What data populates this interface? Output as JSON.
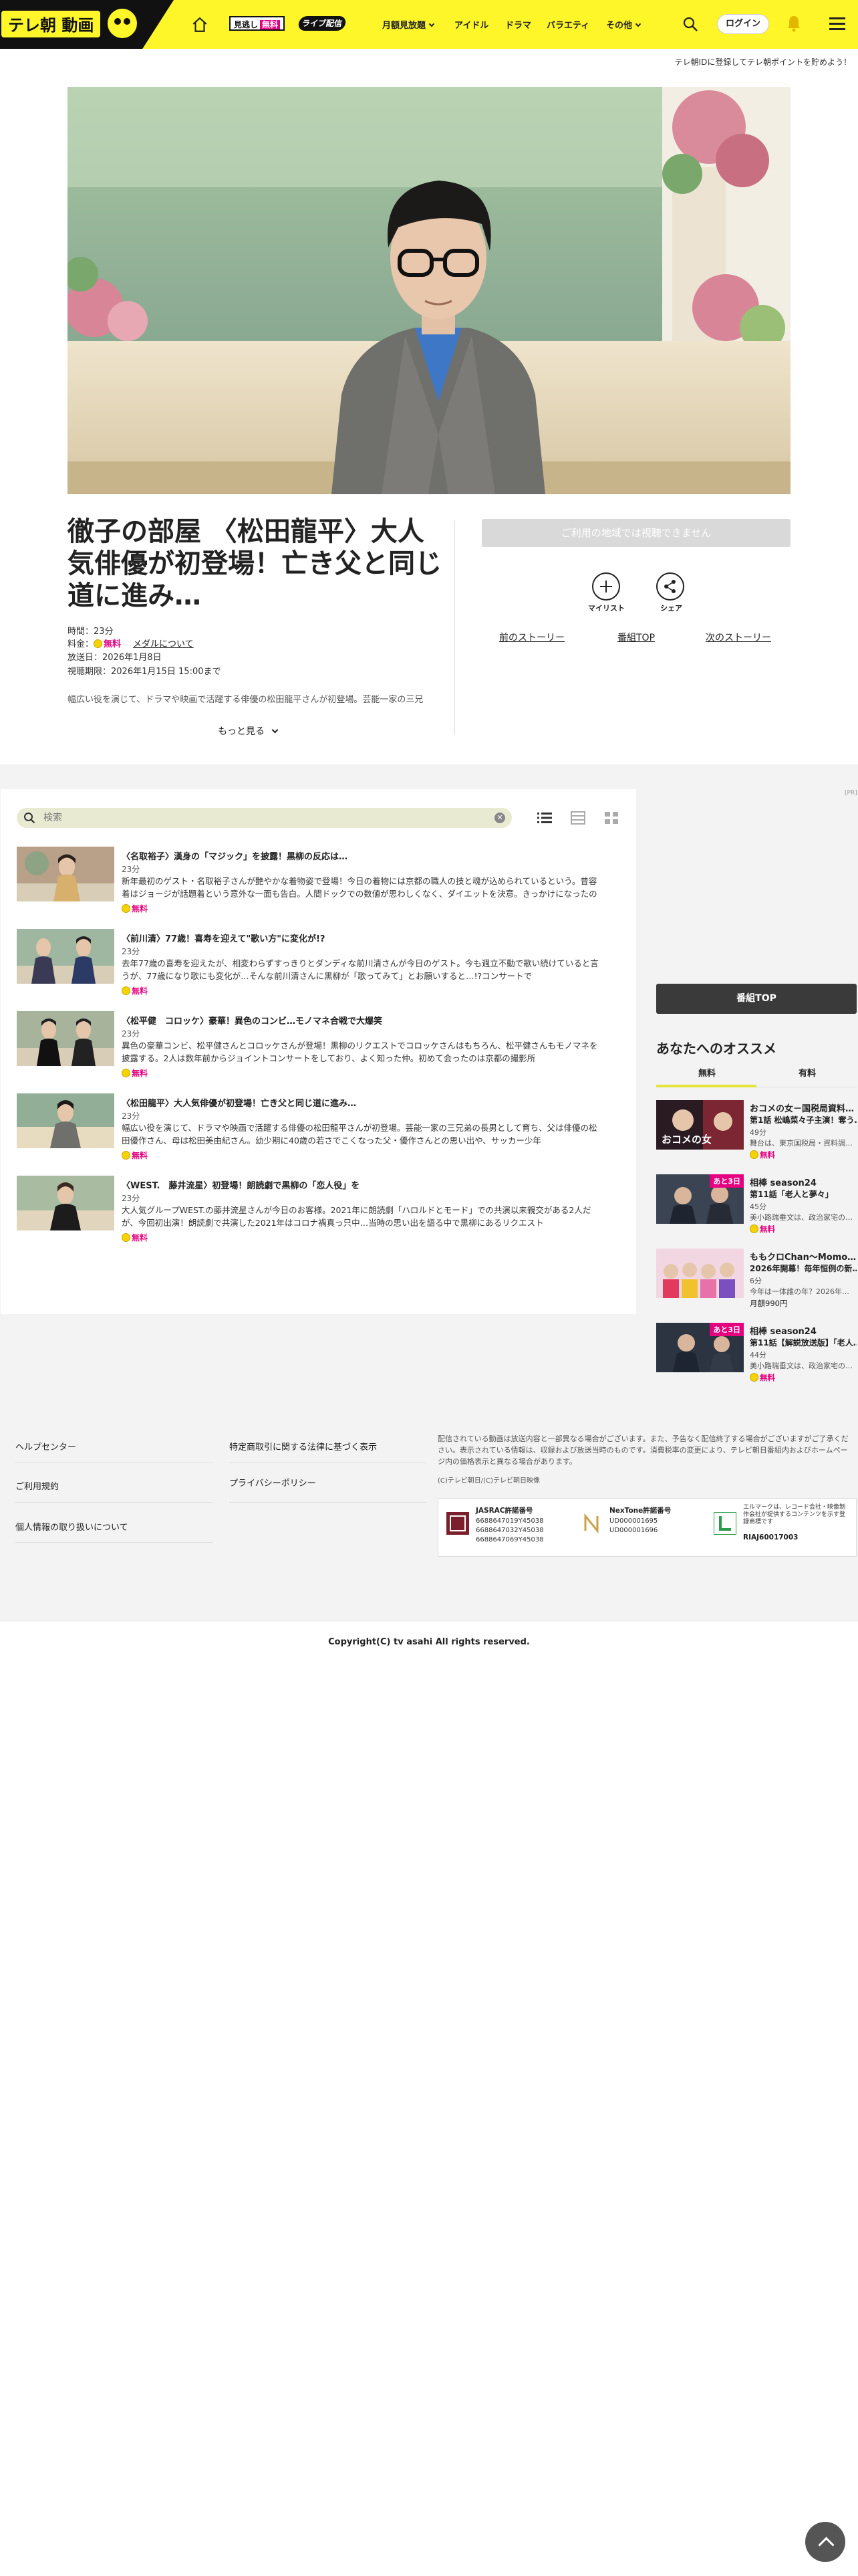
{
  "header": {
    "logo_text": "テレ朝 動画",
    "pill_free_prefix": "見逃し",
    "pill_free_badge": "無料",
    "pill_live": "ライブ配信",
    "nav_items": [
      "月額見放題",
      "アイドル",
      "ドラマ",
      "バラエティ",
      "その他"
    ],
    "login_label": "ログイン"
  },
  "sub_notice": "テレ朝IDに登録してテレ朝ポイントを貯めよう！",
  "program": {
    "title": "徹子の部屋 〈松田龍平〉大人気俳優が初登場！亡き父と同じ道に進み…",
    "duration": "時間：23分",
    "fee_label": "料金：",
    "fee_value": "無料",
    "medal_link": "メダルについて",
    "air_date": "放送日：2026年1月8日",
    "deadline": "視聴期限：2026年1月15日 15:00まで",
    "description": "幅広い役を演じて、ドラマや映画で活躍する俳優の松田龍平さんが初登場。芸能一家の三兄",
    "more_label": "もっと見る",
    "region_notice": "ご利用の地域では視聴できません",
    "mylist_label": "マイリスト",
    "share_label": "シェア",
    "prev_story": "前のストーリー",
    "program_top": "番組TOP",
    "next_story": "次のストーリー"
  },
  "search": {
    "placeholder": "検索"
  },
  "episodes": [
    {
      "title": "〈名取裕子〉漢身の「マジック」を披露！黒柳の反応は…",
      "duration": "23分",
      "description": "新年最初のゲスト・名取裕子さんが艶やかな着物姿で登場！今日の着物には京都の職人の技と魂が込められているという。昔容着はジョージが話題着という意外な一面も告白。人間ドックでの数値が思わしくなく、ダイエットを決意。きっかけになったのは…",
      "badge": "無料"
    },
    {
      "title": "〈前川清〉77歳！喜寿を迎えて\"歌い方\"に変化が!?",
      "duration": "23分",
      "description": "去年77歳の喜寿を迎えたが、相変わらずすっきりとダンディな前川清さんが今日のゲスト。今も週立不動で歌い続けていると言うが、77歳になり歌にも変化が…そんな前川清さんに黒柳が「歌ってみて」とお願いすると…!?コンサートで",
      "badge": "無料"
    },
    {
      "title": "〈松平健　コロッケ〉豪華！異色のコンビ…モノマネ合戦で大爆笑",
      "duration": "23分",
      "description": "異色の豪華コンビ、松平健さんとコロッケさんが登場！黒柳のリクエストでコロッケさんはもちろん、松平健さんもモノマネを披露する。2人は数年前からジョイントコンサートをしており、よく知った仲。初めて会ったのは京都の撮影所",
      "badge": "無料"
    },
    {
      "title": "〈松田龍平〉大人気俳優が初登場！亡き父と同じ道に進み…",
      "duration": "23分",
      "description": "幅広い役を演じて、ドラマや映画で活躍する俳優の松田龍平さんが初登場。芸能一家の三兄弟の長男として育ち、父は俳優の松田優作さん、母は松田美由紀さん。幼少期に40歳の若さでこくなった父・優作さんとの思い出や、サッカー少年",
      "badge": "無料"
    },
    {
      "title": "〈WEST.　藤井流星〉初登場！朗読劇で黒柳の「恋人役」を",
      "duration": "23分",
      "description": "大人気グループWEST.の藤井流星さんが今日のお客様。2021年に朗読劇「ハロルドとモード」での共演以来親交がある2人だが、今回初出演！朗読劇で共演した2021年はコロナ禍真っ只中…当時の思い出を語る中で黒柳にあるリクエスト",
      "badge": "無料"
    }
  ],
  "ad_label": "[PR]",
  "sidebar": {
    "program_top": "番組TOP",
    "rec_heading": "あなたへのオススメ",
    "tab_free": "無料",
    "tab_paid": "有料",
    "items": [
      {
        "title": "おコメの女－国税局資料…",
        "sub": "第1話 松嶋菜々子主演！奪う…",
        "duration": "49分",
        "desc": "舞台は、東京国税局・資料調…",
        "price": "無料",
        "thumb_text": "おコメの女",
        "tag": ""
      },
      {
        "title": "相棒 season24",
        "sub": "第11話「老人と夢々」",
        "duration": "45分",
        "desc": "美小路瑞垂文は、政治家宅の…",
        "price": "無料",
        "thumb_text": "",
        "tag": "あと3日"
      },
      {
        "title": "ももクロChan～Momo…",
        "sub": "2026年開幕！毎年恒例の新…",
        "duration": "6分",
        "desc": "今年は一体誰の年？2026年…",
        "price": "月額990円",
        "thumb_text": "",
        "tag": ""
      },
      {
        "title": "相棒 season24",
        "sub": "第11話【解説放送版】「老人…",
        "duration": "44分",
        "desc": "美小路瑞垂文は、政治家宅の…",
        "price": "無料",
        "thumb_text": "",
        "tag": "あと3日"
      }
    ]
  },
  "footer": {
    "links": [
      "ヘルプセンター",
      "特定商取引に関する法律に基づく表示",
      "ご利用規約",
      "プライバシーポリシー",
      "個人情報の取り扱いについて"
    ],
    "note": "配信されている動画は放送内容と一部異なる場合がございます。また、予告なく配信終了する場合がございますがご了承ください。表示されている情報は、収録および放送当時のものです。消費税率の変更により、テレビ朝日番組内およびホームページ内の価格表示と異なる場合があります。",
    "small_copy": "(C)テレビ朝日/(C)テレビ朝日映像",
    "jasrac_title": "JASRAC許諾番号",
    "jasrac_numbers": "6688647019Y45038\n6688647032Y45038\n6688647069Y45038",
    "nextone_title": "NexTone許諾番号",
    "nextone_numbers": "UD000001695\nUD000001696",
    "lmark_text": "エルマークは、レコード会社・映像制作会社が提供するコンテンツを示す登録商標です",
    "lmark_number": "RIAJ60017003",
    "copyright": "Copyright(C) tv asahi All rights reserved."
  }
}
